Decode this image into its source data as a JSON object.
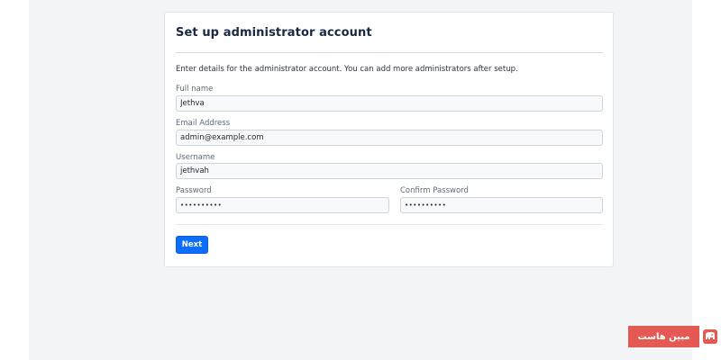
{
  "setup": {
    "title": "Set up administrator account",
    "intro": "Enter details for the administrator account. You can add more administrators after setup.",
    "fields": {
      "full_name": {
        "label": "Full name",
        "value": "Jethva"
      },
      "email": {
        "label": "Email Address",
        "value": "admin@example.com"
      },
      "username": {
        "label": "Username",
        "value": "jethvah"
      },
      "password": {
        "label": "Password",
        "value": "••••••••••"
      },
      "confirm_password": {
        "label": "Confirm Password",
        "value": "••••••••••"
      }
    },
    "next_label": "Next"
  },
  "watermark": {
    "text": "مبین هاست",
    "logo_icon": "elephant-logo-icon"
  },
  "colors": {
    "page_background": "#f3f4f6",
    "primary_button": "#0d6efd",
    "watermark_red": "#e45a53"
  }
}
